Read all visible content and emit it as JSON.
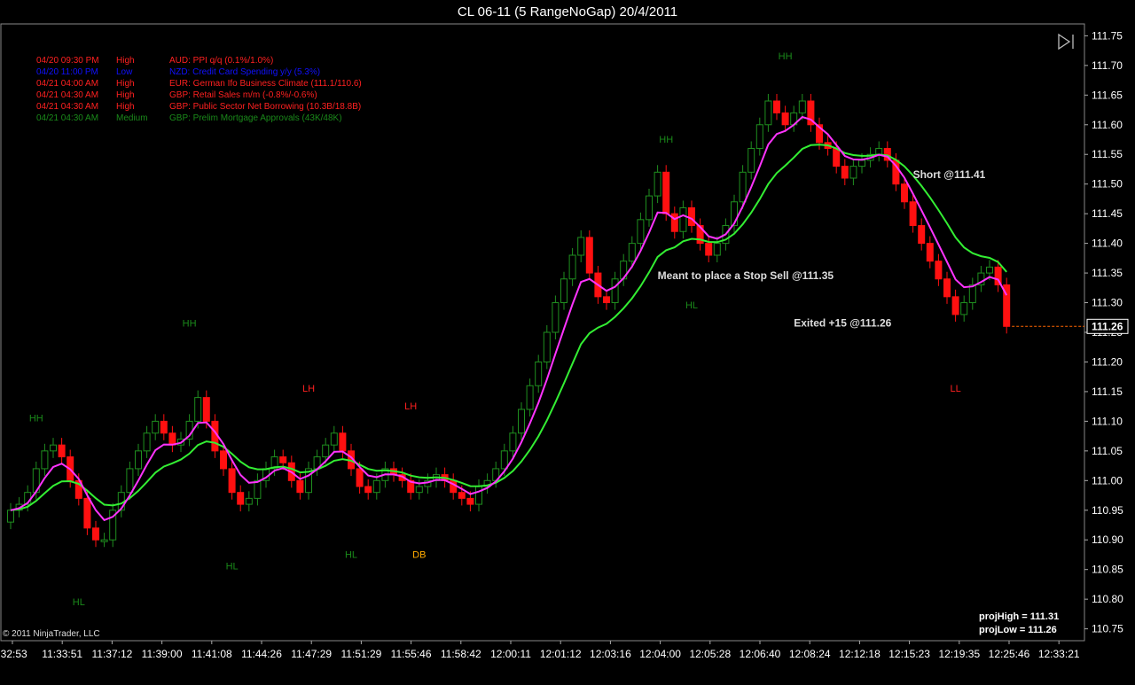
{
  "window": {
    "title": "CL 06-11 (5 RangeNoGap)  20/4/2011"
  },
  "news": [
    {
      "time": "04/20 09:30 PM",
      "impact": "High",
      "event": "AUD: PPI q/q (0.1%/1.0%)",
      "color": "#ff2020"
    },
    {
      "time": "04/20 11:00 PM",
      "impact": "Low",
      "event": "NZD: Credit Card Spending y/y (5.3%)",
      "color": "#1010ff"
    },
    {
      "time": "04/21 04:00 AM",
      "impact": "High",
      "event": "EUR: German Ifo Business Climate (111.1/110.6)",
      "color": "#ff2020"
    },
    {
      "time": "04/21 04:30 AM",
      "impact": "High",
      "event": "GBP: Retail Sales m/m (-0.8%/-0.6%)",
      "color": "#ff2020"
    },
    {
      "time": "04/21 04:30 AM",
      "impact": "High",
      "event": "GBP: Public Sector Net Borrowing (10.3B/18.8B)",
      "color": "#ff2020"
    },
    {
      "time": "04/21 04:30 AM",
      "impact": "Medium",
      "event": "GBP: Prelim Mortgage Approvals (43K/48K)",
      "color": "#1a8a1a"
    }
  ],
  "copyright": "© 2011 NinjaTrader, LLC",
  "proj": {
    "high": "projHigh = 111.31",
    "low": "projLow = 111.26"
  },
  "colors": {
    "up": "#1f8f1f",
    "down": "#ff1010",
    "ema_fast": "#ff33ff",
    "ema_slow": "#33ee33",
    "grid": "#555555"
  },
  "chart_data": {
    "type": "candlestick",
    "ylim": [
      110.73,
      111.77
    ],
    "y_ticks": [
      110.75,
      110.8,
      110.85,
      110.9,
      110.95,
      111.0,
      111.05,
      111.1,
      111.15,
      111.2,
      111.25,
      111.3,
      111.35,
      111.4,
      111.45,
      111.5,
      111.55,
      111.6,
      111.65,
      111.7,
      111.75
    ],
    "x_tick_labels": [
      ":32:53",
      "11:33:51",
      "11:37:12",
      "11:39:00",
      "11:41:08",
      "11:44:26",
      "11:47:29",
      "11:51:29",
      "11:55:46",
      "11:58:42",
      "12:00:11",
      "12:01:12",
      "12:03:16",
      "12:04:00",
      "12:05:28",
      "12:06:40",
      "12:08:24",
      "12:12:18",
      "12:15:23",
      "12:19:35",
      "12:25:46",
      "12:33:21"
    ],
    "last_price": "111.26",
    "close_path": [
      110.95,
      110.96,
      110.98,
      111.02,
      111.05,
      111.06,
      111.04,
      111.0,
      110.97,
      110.92,
      110.9,
      110.9,
      110.95,
      110.98,
      111.02,
      111.05,
      111.08,
      111.1,
      111.08,
      111.06,
      111.07,
      111.1,
      111.14,
      111.1,
      111.05,
      111.02,
      110.98,
      110.96,
      110.97,
      111.0,
      111.02,
      111.04,
      111.03,
      111.0,
      110.98,
      111.02,
      111.04,
      111.06,
      111.08,
      111.05,
      111.02,
      110.99,
      110.98,
      111.0,
      111.02,
      111.01,
      111.0,
      110.98,
      110.99,
      111.0,
      111.01,
      111.0,
      110.98,
      110.97,
      110.96,
      110.99,
      111.0,
      111.02,
      111.05,
      111.08,
      111.12,
      111.16,
      111.2,
      111.25,
      111.3,
      111.34,
      111.38,
      111.41,
      111.35,
      111.31,
      111.3,
      111.34,
      111.37,
      111.4,
      111.44,
      111.48,
      111.52,
      111.45,
      111.42,
      111.46,
      111.43,
      111.4,
      111.38,
      111.4,
      111.43,
      111.47,
      111.52,
      111.56,
      111.6,
      111.64,
      111.62,
      111.6,
      111.62,
      111.64,
      111.6,
      111.57,
      111.56,
      111.53,
      111.51,
      111.53,
      111.54,
      111.55,
      111.56,
      111.54,
      111.5,
      111.47,
      111.43,
      111.4,
      111.37,
      111.34,
      111.31,
      111.28,
      111.3,
      111.33,
      111.35,
      111.36,
      111.33,
      111.26
    ],
    "series": [
      {
        "name": "",
        "values_key": "ema_fast"
      },
      {
        "name": "",
        "values_key": "ema_slow"
      }
    ],
    "annotations": [
      {
        "text": "HH",
        "price": 111.1,
        "idx": 3,
        "color": "#1a8a1a"
      },
      {
        "text": "HL",
        "price": 110.79,
        "idx": 8,
        "color": "#1a8a1a"
      },
      {
        "text": "HH",
        "price": 111.26,
        "idx": 21,
        "color": "#1a8a1a"
      },
      {
        "text": "HL",
        "price": 110.85,
        "idx": 26,
        "color": "#1a8a1a"
      },
      {
        "text": "LH",
        "price": 111.15,
        "idx": 35,
        "color": "#ff2020"
      },
      {
        "text": "HL",
        "price": 110.87,
        "idx": 40,
        "color": "#1a8a1a"
      },
      {
        "text": "LH",
        "price": 111.12,
        "idx": 47,
        "color": "#ff2020"
      },
      {
        "text": "DB",
        "price": 110.87,
        "idx": 48,
        "color": "#ffaa00"
      },
      {
        "text": "HH",
        "price": 111.57,
        "idx": 77,
        "color": "#1a8a1a"
      },
      {
        "text": "HL",
        "price": 111.29,
        "idx": 80,
        "color": "#1a8a1a"
      },
      {
        "text": "HH",
        "price": 111.71,
        "idx": 91,
        "color": "#1a8a1a"
      },
      {
        "text": "LL",
        "price": 111.15,
        "idx": 111,
        "color": "#ff2020"
      }
    ],
    "notes": [
      {
        "text": "Short @111.41",
        "price": 111.51,
        "idx": 106
      },
      {
        "text": "Meant to place a Stop Sell @111.35",
        "price": 111.34,
        "idx": 76
      },
      {
        "text": "Exited +15 @111.26",
        "price": 111.26,
        "idx": 92
      }
    ]
  }
}
